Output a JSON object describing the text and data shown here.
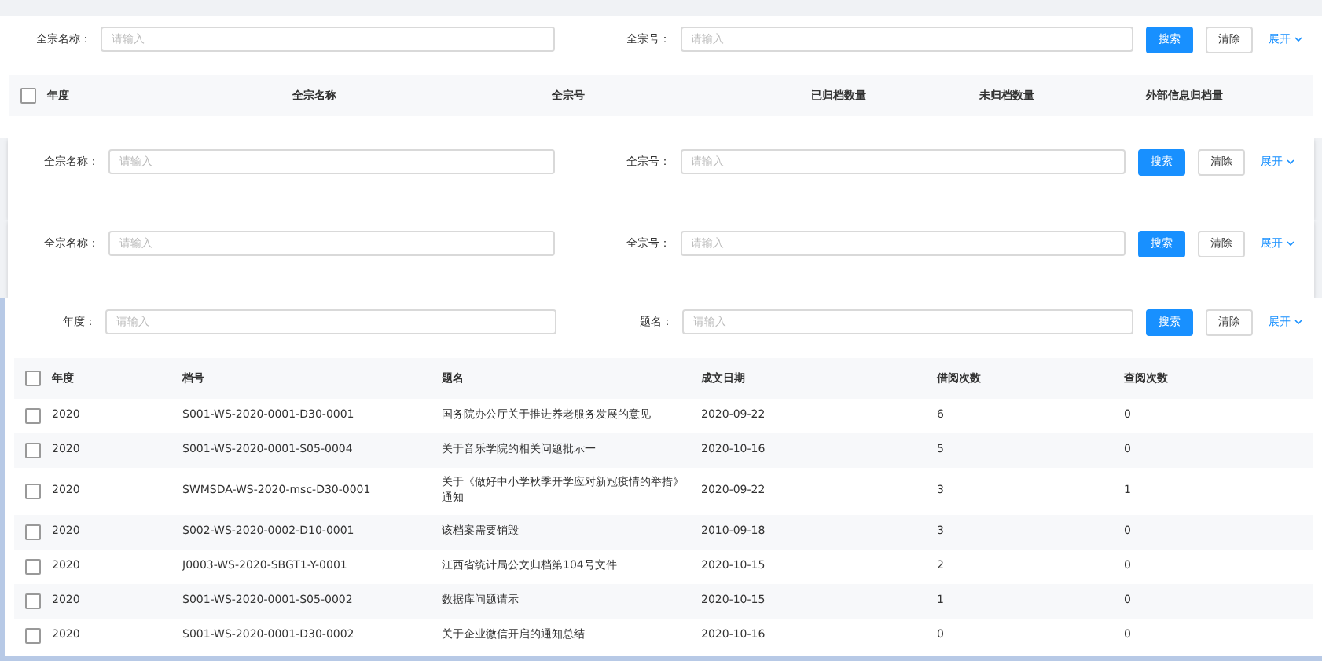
{
  "panels": [
    {
      "kind": "full",
      "filters": [
        {
          "label": "全宗名称：",
          "placeholder": "请输入"
        },
        {
          "label": "全宗号：",
          "placeholder": "请输入"
        }
      ],
      "search": "搜索",
      "clear": "清除",
      "expand": "展开",
      "columns": [
        "年度",
        "全宗名称",
        "全宗号",
        "已归档数量",
        "未归档数量",
        "外部信息归档量"
      ],
      "header_checked": false
    },
    {
      "kind": "card",
      "filters": [
        {
          "label": "全宗名称：",
          "placeholder": "请输入"
        },
        {
          "label": "全宗号：",
          "placeholder": "请输入"
        }
      ],
      "search": "搜索",
      "clear": "清除",
      "expand": "展开"
    },
    {
      "kind": "card",
      "filters": [
        {
          "label": "全宗名称：",
          "placeholder": "请输入"
        },
        {
          "label": "全宗号：",
          "placeholder": "请输入"
        }
      ],
      "search": "搜索",
      "clear": "清除",
      "expand": "展开"
    }
  ],
  "main": {
    "filters": [
      {
        "label": "年度：",
        "placeholder": "请输入"
      },
      {
        "label": "题名：",
        "placeholder": "请输入"
      }
    ],
    "search": "搜索",
    "clear": "清除",
    "expand": "展开",
    "columns": [
      "年度",
      "档号",
      "题名",
      "成文日期",
      "借阅次数",
      "查阅次数"
    ],
    "header_checked": false,
    "rows": [
      {
        "checked": false,
        "cells": [
          "2020",
          "S001-WS-2020-0001-D30-0001",
          "国务院办公厅关于推进养老服务发展的意见",
          "2020-09-22",
          "6",
          "0"
        ]
      },
      {
        "checked": false,
        "cells": [
          "2020",
          "S001-WS-2020-0001-S05-0004",
          "关于音乐学院的相关问题批示一",
          "2020-10-16",
          "5",
          "0"
        ]
      },
      {
        "checked": false,
        "cells": [
          "2020",
          "SWMSDA-WS-2020-msc-D30-0001",
          "关于《做好中小学秋季开学应对新冠疫情的举措》通知",
          "2020-09-22",
          "3",
          "1"
        ]
      },
      {
        "checked": false,
        "cells": [
          "2020",
          "S002-WS-2020-0002-D10-0001",
          "该档案需要销毁",
          "2010-09-18",
          "3",
          "0"
        ]
      },
      {
        "checked": false,
        "cells": [
          "2020",
          "J0003-WS-2020-SBGT1-Y-0001",
          "江西省统计局公文归档第104号文件",
          "2020-10-15",
          "2",
          "0"
        ]
      },
      {
        "checked": false,
        "cells": [
          "2020",
          "S001-WS-2020-0001-S05-0002",
          "数据库问题请示",
          "2020-10-15",
          "1",
          "0"
        ]
      },
      {
        "checked": false,
        "cells": [
          "2020",
          "S001-WS-2020-0001-D30-0002",
          "关于企业微信开启的通知总结",
          "2020-10-16",
          "0",
          "0"
        ]
      }
    ]
  }
}
